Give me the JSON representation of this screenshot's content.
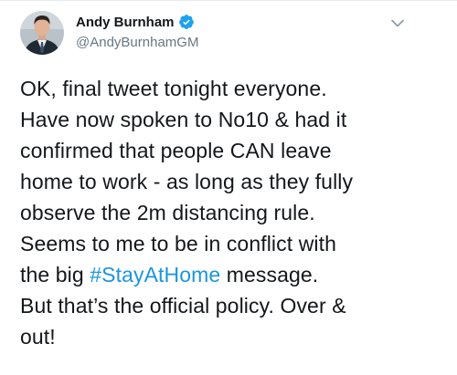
{
  "author": {
    "display_name": "Andy Burnham",
    "handle": "@AndyBurnhamGM",
    "verified": true,
    "avatar_icon": "profile-photo",
    "verified_icon": "verified-badge-icon",
    "menu_icon": "chevron-down-icon"
  },
  "tweet": {
    "lines": [
      {
        "before": "OK, final tweet tonight everyone.",
        "hashtag": "",
        "after": ""
      },
      {
        "before": "Have now spoken to No10 & had it",
        "hashtag": "",
        "after": ""
      },
      {
        "before": "confirmed that people CAN leave",
        "hashtag": "",
        "after": ""
      },
      {
        "before": "home to work - as long as they fully",
        "hashtag": "",
        "after": ""
      },
      {
        "before": "observe the 2m distancing rule.",
        "hashtag": "",
        "after": ""
      },
      {
        "before": "Seems to me to be in conflict with",
        "hashtag": "",
        "after": ""
      },
      {
        "before": "the big ",
        "hashtag": "#StayAtHome",
        "after": " message."
      },
      {
        "before": "But that’s the official policy. Over &",
        "hashtag": "",
        "after": ""
      },
      {
        "before": "out!",
        "hashtag": "",
        "after": ""
      }
    ]
  },
  "colors": {
    "text": "#14171a",
    "secondary": "#657786",
    "link": "#1b95e0",
    "verified": "#1da1f2"
  }
}
